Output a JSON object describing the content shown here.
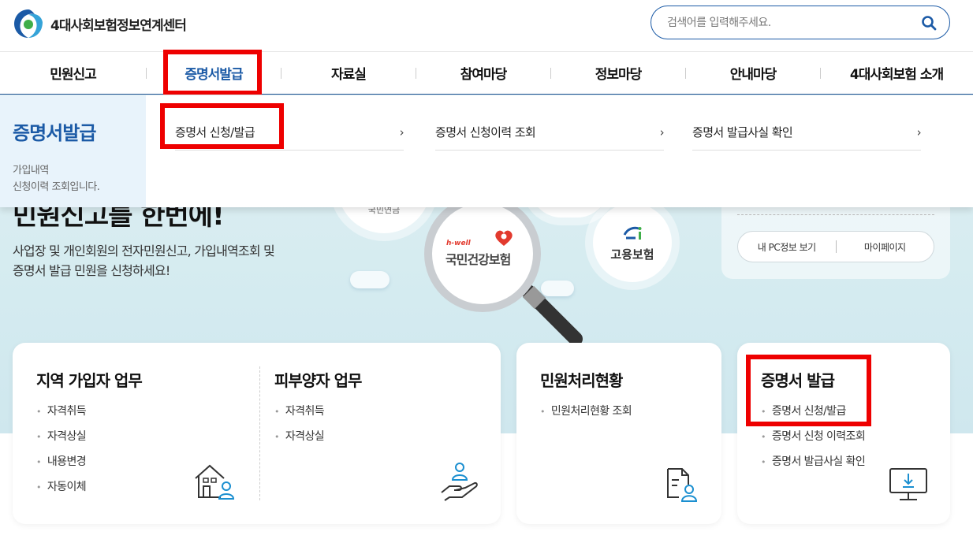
{
  "header": {
    "logo_text": "4대사회보험정보연계센터",
    "search_placeholder": "검색어를 입력해주세요."
  },
  "gnb": {
    "items": [
      "민원신고",
      "증명서발급",
      "자료실",
      "참여마당",
      "정보마당",
      "안내마당",
      "4대사회보험 소개"
    ],
    "active_index": 1
  },
  "mega_menu": {
    "title": "증명서발급",
    "description_line1": "가입내역",
    "description_line2": "신청이력 조회입니다.",
    "links": [
      "증명서 신청/발급",
      "증명서 신청이력 조회",
      "증명서 발급사실 확인"
    ]
  },
  "hero": {
    "title": "민원신고를 한번에!",
    "desc_line1": "사업장 및 개인회원의 전자민원신고, 가입내역조회 및",
    "desc_line2": "증명서 발급 민원을 신청하세요!",
    "circle_labels": {
      "pension": "국민연금",
      "health_sub": "h-well",
      "health": "국민건강보험",
      "employment": "고용보험"
    }
  },
  "login_box": {
    "my_pc": "내 PC정보 보기",
    "mypage": "마이페이지"
  },
  "cards": {
    "regional": {
      "title": "지역 가입자 업무",
      "items": [
        "자격취득",
        "자격상실",
        "내용변경",
        "자동이체"
      ]
    },
    "dependent": {
      "title": "피부양자 업무",
      "items": [
        "자격취득",
        "자격상실"
      ]
    },
    "status": {
      "title": "민원처리현황",
      "items": [
        "민원처리현황 조회"
      ]
    },
    "certificate": {
      "title": "증명서 발급",
      "items": [
        "증명서 신청/발급",
        "증명서 신청 이력조회",
        "증명서 발급사실 확인"
      ]
    }
  },
  "colors": {
    "brand_blue": "#1b5aa6",
    "highlight_red": "#ee0000"
  }
}
